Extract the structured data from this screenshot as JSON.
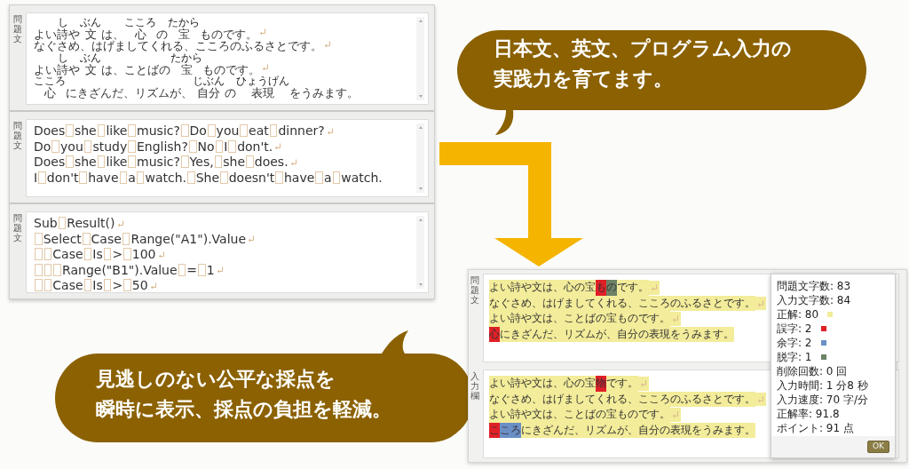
{
  "editor_panels": [
    {
      "label": "問題文",
      "kind": "ruby",
      "lines": [
        {
          "segments": [
            {
              "text": "よい"
            },
            {
              "text": "詩",
              "ruby": "し"
            },
            {
              "text": "や"
            },
            {
              "text": "文",
              "ruby": "ぶん"
            },
            {
              "text": "は、"
            },
            {
              "text": "心",
              "ruby": "こころ"
            },
            {
              "text": "の"
            },
            {
              "text": "宝",
              "ruby": "たから"
            },
            {
              "text": "ものです。"
            }
          ],
          "return_mark": true
        },
        {
          "segments": [
            {
              "text": "なぐさめ、はげましてくれる、こころのふるさとです。"
            }
          ],
          "return_mark": true
        },
        {
          "segments": [
            {
              "text": "よい"
            },
            {
              "text": "詩",
              "ruby": "し"
            },
            {
              "text": "や"
            },
            {
              "text": "文",
              "ruby": "ぶん"
            },
            {
              "text": "は、ことばの"
            },
            {
              "text": "宝",
              "ruby": "たから"
            },
            {
              "text": "ものです。"
            }
          ],
          "return_mark": true
        },
        {
          "segments": [
            {
              "text": "心",
              "ruby": "こころ"
            },
            {
              "text": "にきざんだ、リズムが、"
            },
            {
              "text": "自分",
              "ruby": "じぶん"
            },
            {
              "text": "の"
            },
            {
              "text": "表現",
              "ruby": "ひょうげん"
            },
            {
              "text": "をうみます。"
            }
          ],
          "return_mark": false
        }
      ]
    },
    {
      "label": "問題文",
      "kind": "plain",
      "lines": [
        {
          "text": "Does she like music? Do you eat dinner?",
          "return_mark": true
        },
        {
          "text": "Do you study English? No I don't.",
          "return_mark": true
        },
        {
          "text": "Does she like music? Yes, she does.",
          "return_mark": true
        },
        {
          "text": "I don't have a watch. She doesn't have a watch.",
          "return_mark": false
        }
      ]
    },
    {
      "label": "問題文",
      "kind": "plain",
      "lines": [
        {
          "text": "Sub Result()",
          "return_mark": true
        },
        {
          "text": " Select Case Range(\"A1\").Value",
          "return_mark": true
        },
        {
          "text": "  Case Is > 100",
          "return_mark": true
        },
        {
          "text": "   Range(\"B1\").Value = 1",
          "return_mark": true
        },
        {
          "text": "  Case Is > 50",
          "return_mark": true
        }
      ]
    }
  ],
  "callouts": [
    {
      "lines": [
        "日本文、英文、プログラム入力の",
        "実践力を育てます。"
      ]
    },
    {
      "lines": [
        "見逃しのない公平な採点を",
        "瞬時に表示、採点の負担を軽減。"
      ]
    }
  ],
  "result_window": {
    "panels": [
      {
        "label": "問題文",
        "lines": [
          {
            "segments": [
              {
                "text": "よい詩や文は、心の宝",
                "color": "#f3ec9a"
              },
              {
                "text": "も",
                "color": "#e02027"
              },
              {
                "text": "の",
                "color": "#6e8266"
              },
              {
                "text": "です。",
                "color": "#f3ec9a"
              }
            ],
            "return_mark": true
          },
          {
            "segments": [
              {
                "text": "なぐさめ、はげましてくれる、こころのふるさとです。",
                "color": "#f3ec9a"
              }
            ],
            "return_mark": true
          },
          {
            "segments": [
              {
                "text": "よい詩や文は、ことばの宝ものです。",
                "color": "#f3ec9a"
              }
            ],
            "return_mark": true
          },
          {
            "segments": [
              {
                "text": "心",
                "color": "#e02027"
              },
              {
                "text": "にきざんだ、リズムが、自分の表現をうみます。",
                "color": "#f3ec9a"
              }
            ],
            "return_mark": false
          }
        ]
      },
      {
        "label": "入力欄",
        "lines": [
          {
            "segments": [
              {
                "text": "よい詩や文は、心の宝",
                "color": "#f3ec9a"
              },
              {
                "text": "物",
                "color": "#e02027"
              },
              {
                "text": "です。",
                "color": "#f3ec9a"
              }
            ],
            "return_mark": true
          },
          {
            "segments": [
              {
                "text": "なぐさめ、はげましてくれる、こころのふるさとです。",
                "color": "#f3ec9a"
              }
            ],
            "return_mark": true
          },
          {
            "segments": [
              {
                "text": "よい詩や文は、ことばの宝ものです。",
                "color": "#f3ec9a"
              }
            ],
            "return_mark": true
          },
          {
            "segments": [
              {
                "text": "こ",
                "color": "#e02027"
              },
              {
                "text": "ころ",
                "color": "#6b8fc6"
              },
              {
                "text": "にきざんだ、リズムが、自分の表現をうみます。",
                "color": "#f3ec9a"
              }
            ],
            "return_mark": false
          }
        ]
      }
    ],
    "stats": [
      {
        "text": "問題文字数: 83"
      },
      {
        "text": "入力文字数: 84"
      },
      {
        "text": "正解: 80",
        "color": "#f3ec9a"
      },
      {
        "text": "誤字: 2",
        "color": "#e02027"
      },
      {
        "text": "余字: 2",
        "color": "#6b8fc6"
      },
      {
        "text": "脱字: 1",
        "color": "#6e8266"
      },
      {
        "text": "削除回数: 0 回"
      },
      {
        "text": "入力時間: 1 分8 秒"
      },
      {
        "text": "入力速度: 70 字/分"
      },
      {
        "text": "正解率: 91.8"
      },
      {
        "text": "ポイント: 91 点"
      }
    ],
    "ok_button": "OK"
  }
}
